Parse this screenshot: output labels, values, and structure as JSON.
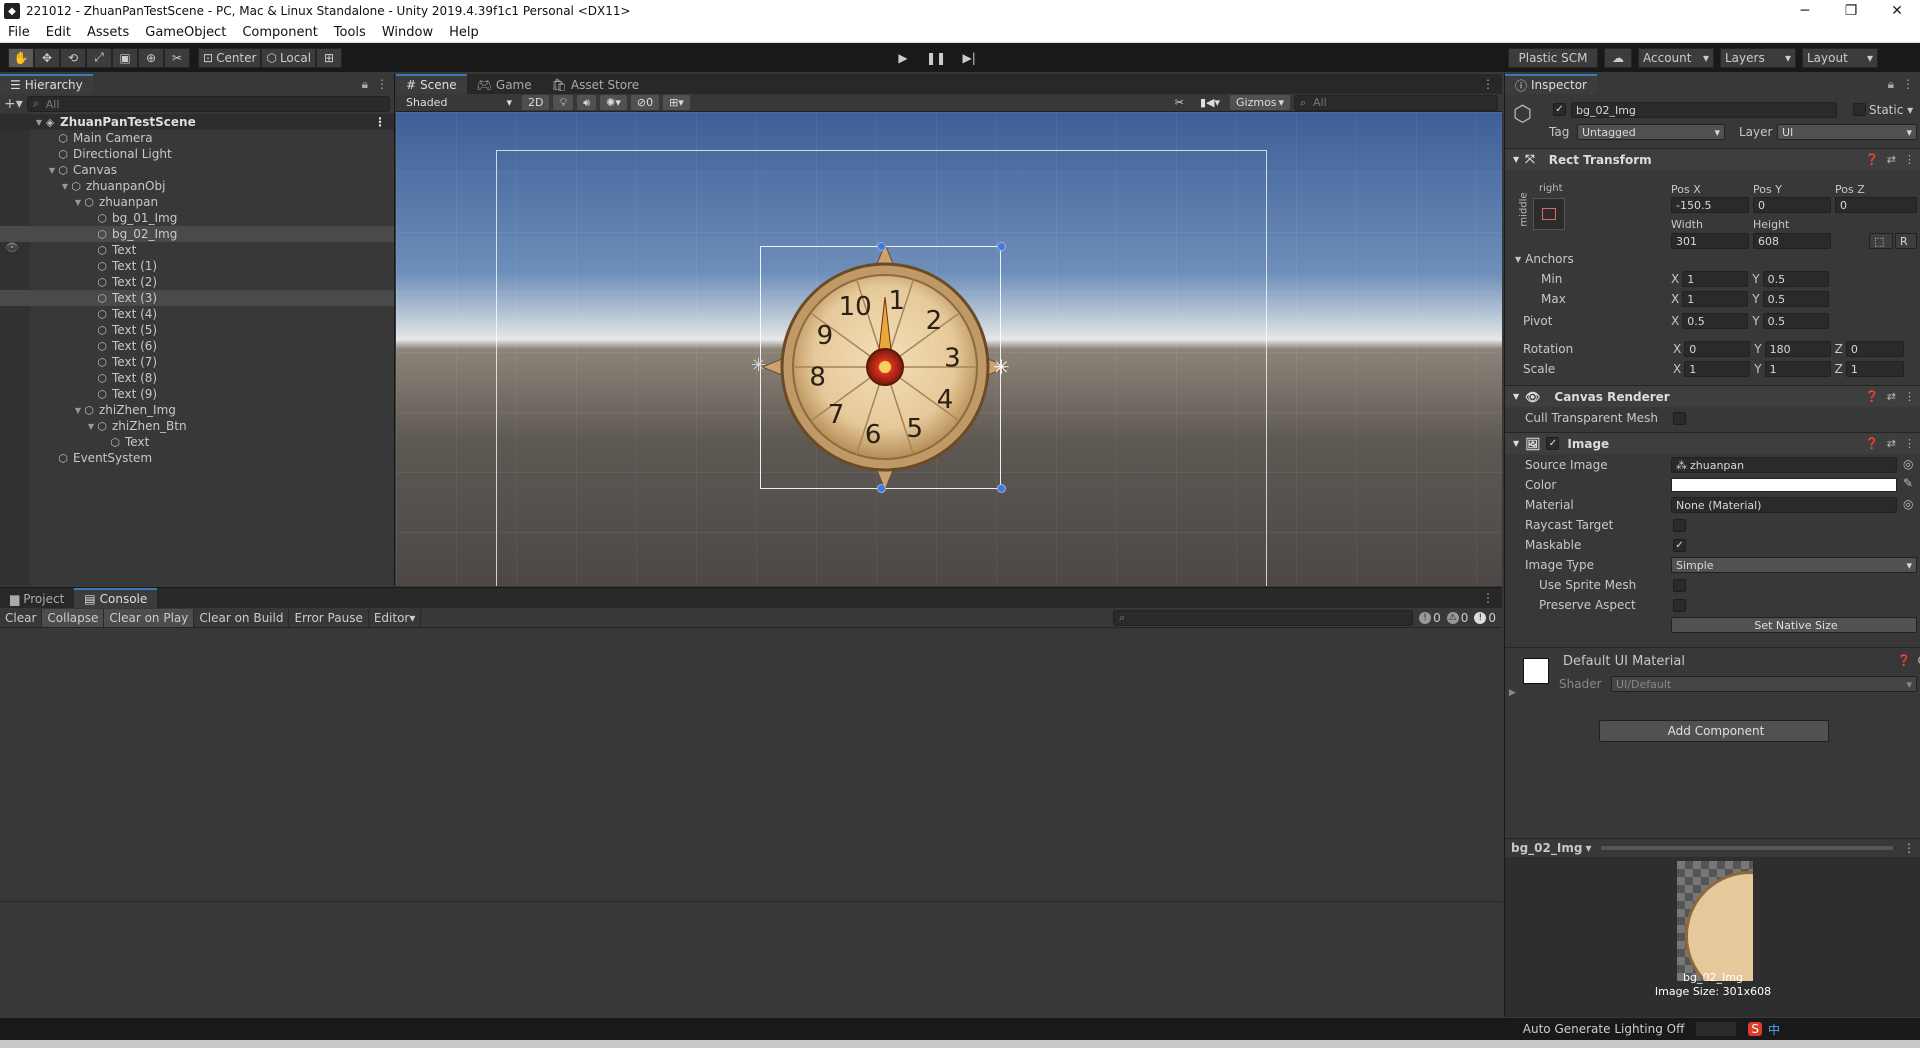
{
  "window": {
    "title": "221012 - ZhuanPanTestScene - PC, Mac & Linux Standalone - Unity 2019.4.39f1c1 Personal <DX11>",
    "minimize": "─",
    "maximize": "❐",
    "close": "✕"
  },
  "menu": [
    "File",
    "Edit",
    "Assets",
    "GameObject",
    "Component",
    "Tools",
    "Window",
    "Help"
  ],
  "toolbar": {
    "center_label": "Center",
    "local_label": "Local",
    "plastic_label": "Plastic SCM",
    "account_label": "Account",
    "layers_label": "Layers",
    "layout_label": "Layout"
  },
  "hierarchy": {
    "tab_label": "Hierarchy",
    "search_placeholder": "All",
    "items": [
      {
        "label": "ZhuanPanTestScene",
        "depth": 0
      },
      {
        "label": "Main Camera",
        "depth": 1
      },
      {
        "label": "Directional Light",
        "depth": 1
      },
      {
        "label": "Canvas",
        "depth": 1
      },
      {
        "label": "zhuanpanObj",
        "depth": 2
      },
      {
        "label": "zhuanpan",
        "depth": 3
      },
      {
        "label": "bg_01_Img",
        "depth": 4
      },
      {
        "label": "bg_02_Img",
        "depth": 4
      },
      {
        "label": "Text",
        "depth": 4
      },
      {
        "label": "Text (1)",
        "depth": 4
      },
      {
        "label": "Text (2)",
        "depth": 4
      },
      {
        "label": "Text (3)",
        "depth": 4
      },
      {
        "label": "Text (4)",
        "depth": 4
      },
      {
        "label": "Text (5)",
        "depth": 4
      },
      {
        "label": "Text (6)",
        "depth": 4
      },
      {
        "label": "Text (7)",
        "depth": 4
      },
      {
        "label": "Text (8)",
        "depth": 4
      },
      {
        "label": "Text (9)",
        "depth": 4
      },
      {
        "label": "zhiZhen_Img",
        "depth": 3
      },
      {
        "label": "zhiZhen_Btn",
        "depth": 4
      },
      {
        "label": "Text",
        "depth": 5
      },
      {
        "label": "EventSystem",
        "depth": 1
      }
    ]
  },
  "scene": {
    "tabs": [
      "Scene",
      "Game",
      "Asset Store"
    ],
    "shading": "Shaded",
    "mode_2d": "2D",
    "hidden_count": "0",
    "gizmos": "Gizmos",
    "search_placeholder": "All",
    "wheel_numbers": [
      "1",
      "2",
      "3",
      "4",
      "5",
      "6",
      "7",
      "8",
      "9",
      "10"
    ]
  },
  "console": {
    "tabs": [
      "Project",
      "Console"
    ],
    "buttons": [
      "Clear",
      "Collapse",
      "Clear on Play",
      "Clear on Build",
      "Error Pause",
      "Editor"
    ],
    "counts": {
      "log": "0",
      "warn": "0",
      "error": "0"
    }
  },
  "inspector": {
    "tab_label": "Inspector",
    "object_name": "bg_02_Img",
    "static_label": "Static",
    "tag_label": "Tag",
    "tag_value": "Untagged",
    "layer_label": "Layer",
    "layer_value": "UI",
    "rect_transform": {
      "title": "Rect Transform",
      "anchor_h": "right",
      "anchor_v": "middle",
      "pos_x_label": "Pos X",
      "pos_x": "-150.5",
      "pos_y_label": "Pos Y",
      "pos_y": "0",
      "pos_z_label": "Pos Z",
      "pos_z": "0",
      "width_label": "Width",
      "width": "301",
      "height_label": "Height",
      "height": "608",
      "r_button": "R",
      "anchors_label": "Anchors",
      "min_label": "Min",
      "min_x": "1",
      "min_y": "0.5",
      "max_label": "Max",
      "max_x": "1",
      "max_y": "0.5",
      "pivot_label": "Pivot",
      "pivot_x": "0.5",
      "pivot_y": "0.5",
      "rotation_label": "Rotation",
      "rot_x": "0",
      "rot_y": "180",
      "rot_z": "0",
      "scale_label": "Scale",
      "scale_x": "1",
      "scale_y": "1",
      "scale_z": "1",
      "x": "X",
      "y": "Y",
      "z": "Z"
    },
    "canvas_renderer": {
      "title": "Canvas Renderer",
      "cull_label": "Cull Transparent Mesh"
    },
    "image": {
      "title": "Image",
      "source_label": "Source Image",
      "source_value": "zhuanpan",
      "color_label": "Color",
      "material_label": "Material",
      "material_value": "None (Material)",
      "raycast_label": "Raycast Target",
      "maskable_label": "Maskable",
      "image_type_label": "Image Type",
      "image_type_value": "Simple",
      "sprite_mesh_label": "Use Sprite Mesh",
      "preserve_label": "Preserve Aspect",
      "native_size_btn": "Set Native Size"
    },
    "material": {
      "title": "Default UI Material",
      "shader_label": "Shader",
      "shader_value": "UI/Default"
    },
    "add_component": "Add Component",
    "preview": {
      "name": "bg_02_Img",
      "caption_name": "bg_02_Img",
      "caption_size": "Image Size: 301x608"
    }
  },
  "status": {
    "lighting": "Auto Generate Lighting Off",
    "ime": "中"
  },
  "colors": {
    "accent": "#3a79bb",
    "selection": "#4a4a4a",
    "handle": "#3a7de0"
  }
}
